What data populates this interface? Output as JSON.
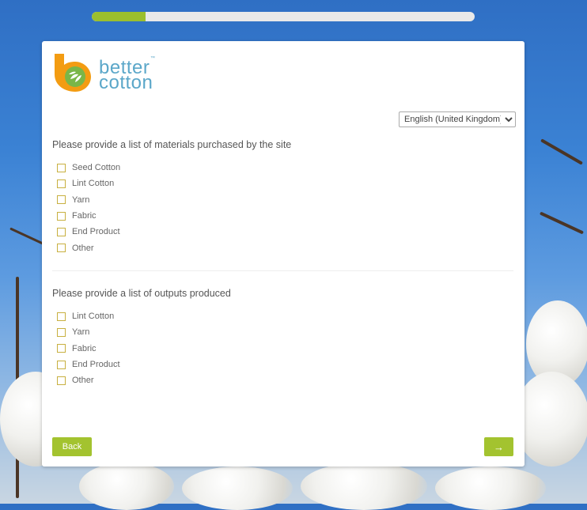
{
  "progress": {
    "fraction": 0.14
  },
  "logo": {
    "line1": "better",
    "line2": "cotton",
    "tm": "™"
  },
  "language": {
    "selected": "English (United Kingdom)"
  },
  "section1": {
    "question": "Please provide a list of materials purchased by the site",
    "options": [
      "Seed Cotton",
      "Lint Cotton",
      "Yarn",
      "Fabric",
      "End Product",
      "Other"
    ]
  },
  "section2": {
    "question": "Please provide a list of outputs produced",
    "options": [
      "Lint Cotton",
      "Yarn",
      "Fabric",
      "End Product",
      "Other"
    ]
  },
  "buttons": {
    "back": "Back",
    "next": "→"
  },
  "colors": {
    "accent": "#a3c32f",
    "logo_text": "#5ba7c9"
  }
}
